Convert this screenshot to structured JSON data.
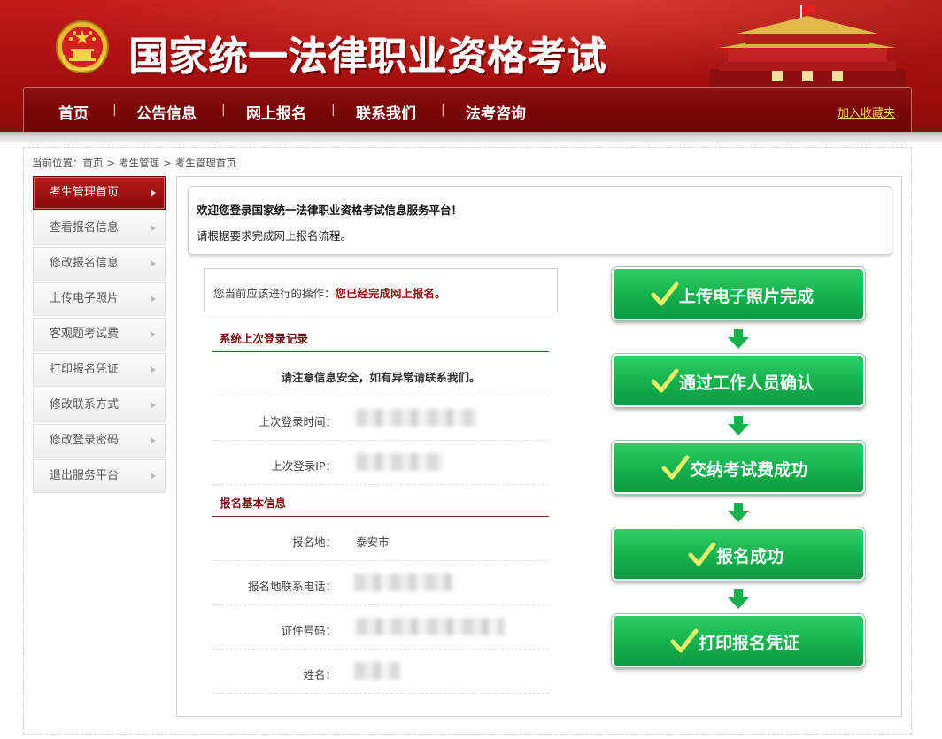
{
  "header": {
    "site_title": "国家统一法律职业资格考试",
    "colors": {
      "header_red": "#b41414",
      "nav_dark": "#7a0707",
      "accent_gold": "#f7d85a",
      "step_green": "#14b04c"
    },
    "emblem_icon": "national-emblem-icon",
    "tower_image": "tiananmen-image"
  },
  "nav": {
    "items": [
      "首页",
      "公告信息",
      "网上报名",
      "联系我们",
      "法考咨询"
    ],
    "separator": "|",
    "favorite_link": "加入收藏夹"
  },
  "breadcrumb": {
    "prefix": "当前位置：",
    "items": [
      "首页",
      ">",
      "考生管理",
      ">",
      "考生管理首页"
    ]
  },
  "sidebar": {
    "items": [
      {
        "label": "考生管理首页",
        "active": true
      },
      {
        "label": "查看报名信息",
        "active": false
      },
      {
        "label": "修改报名信息",
        "active": false
      },
      {
        "label": "上传电子照片",
        "active": false
      },
      {
        "label": "客观题考试费",
        "active": false
      },
      {
        "label": "打印报名凭证",
        "active": false
      },
      {
        "label": "修改联系方式",
        "active": false
      },
      {
        "label": "修改登录密码",
        "active": false
      },
      {
        "label": "退出服务平台",
        "active": false
      }
    ],
    "arrow_icon": "triangle-right-icon"
  },
  "welcome": {
    "line1": "欢迎您登录国家统一法律职业资格考试信息服务平台！",
    "line2": "请根据要求完成网上报名流程。"
  },
  "operation": {
    "prefix": "您当前应该进行的操作：",
    "status": "您已经完成网上报名。"
  },
  "login_record": {
    "title": "系统上次登录记录",
    "notice": "请注意信息安全，如有异常请联系我们。",
    "last_time_label": "上次登录时间：",
    "last_ip_label": "上次登录IP："
  },
  "basic_info": {
    "title": "报名基本信息",
    "location_label": "报名地：",
    "location_value": "泰安市",
    "phone_label": "报名地联系电话：",
    "id_label": "证件号码：",
    "name_label": "姓名："
  },
  "steps": {
    "items": [
      "上传电子照片完成",
      "通过工作人员确认",
      "交纳考试费成功",
      "报名成功",
      "打印报名凭证"
    ],
    "check_icon": "check-icon",
    "arrow_icon": "arrow-down-icon"
  }
}
